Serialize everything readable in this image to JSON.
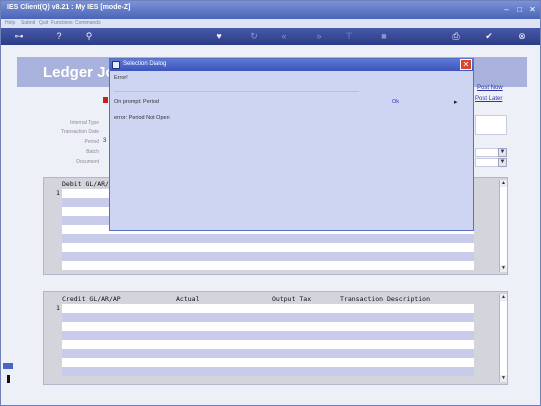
{
  "window": {
    "title": "IES Client(Q) v8.21 : My IES      [mode-Z]",
    "controls": [
      "–",
      "□",
      "✕"
    ]
  },
  "menu": [
    "Help",
    "Subnit",
    "Quit",
    "Functions",
    "Commands"
  ],
  "toolbar": {
    "icons": [
      "key-icon",
      "help-icon",
      "search-icon",
      "heart-icon",
      "refresh-icon",
      "first-icon",
      "last-icon",
      "filter-icon",
      "stop-icon",
      "print-icon",
      "check-icon",
      "close-icon"
    ]
  },
  "ledger": {
    "banner_title": "Ledger Jou",
    "post_now": "Post Now",
    "post_later": "Post Later",
    "fields": [
      {
        "label": "Internal Type"
      },
      {
        "label": "Transaction Date"
      },
      {
        "label": "Period",
        "value": "3"
      },
      {
        "label": "Batch"
      },
      {
        "label": "Document"
      }
    ],
    "debit_grid": {
      "header": "Debit GL/AR/A",
      "row_number": "1"
    },
    "credit_grid": {
      "headers": [
        "Credit GL/AR/AP",
        "Actual",
        "Output Tax",
        "Transaction Description"
      ],
      "row_number": "1"
    }
  },
  "dialog": {
    "title": "Selection Dialog",
    "heading": "Error!",
    "item_label": "On prompt: Period",
    "ok_label": "Ok",
    "arrow": "▸",
    "message": "error: Period Not Open",
    "close_glyph": "✕"
  }
}
